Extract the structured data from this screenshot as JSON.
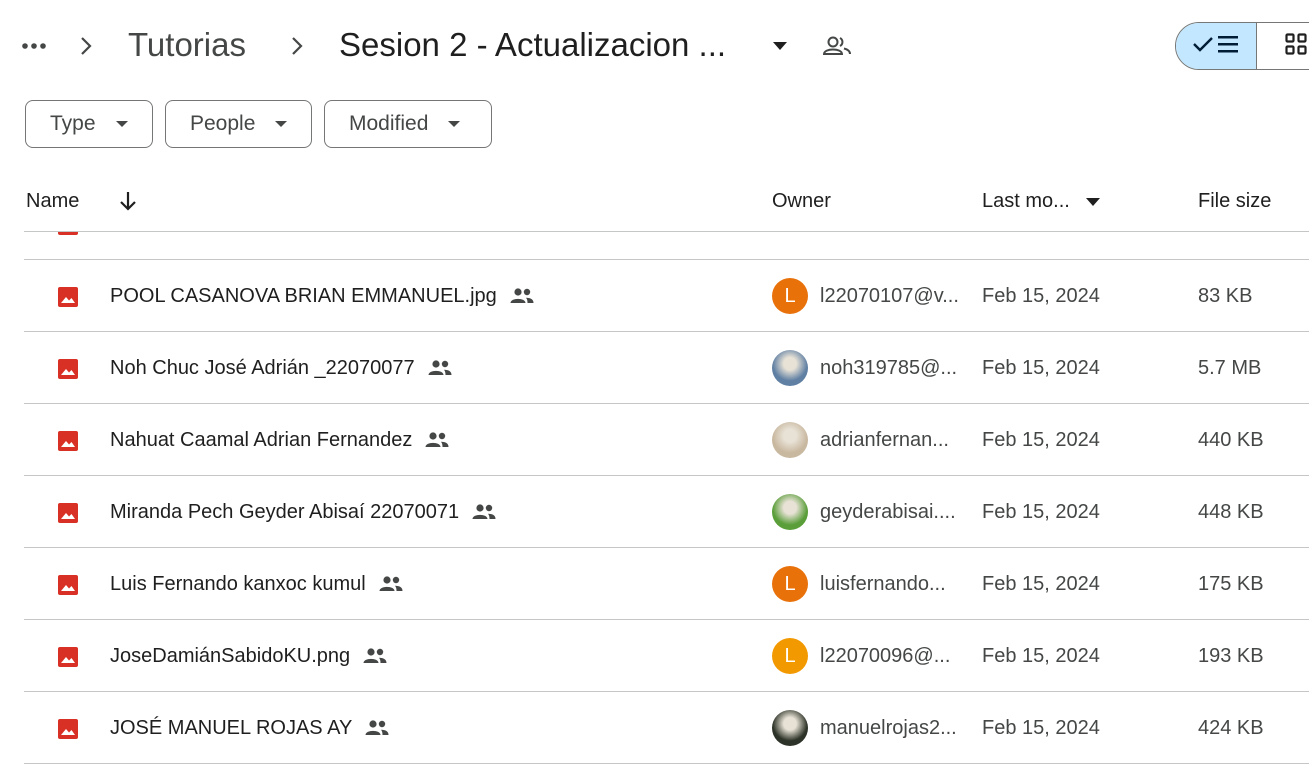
{
  "breadcrumb": {
    "items": [
      "Tutorias",
      "Sesion 2 - Actualizacion ..."
    ]
  },
  "view": {
    "list_icon": "checkmark-list-icon",
    "grid_icon": "grid-icon"
  },
  "filters": [
    {
      "label": "Type"
    },
    {
      "label": "People"
    },
    {
      "label": "Modified"
    }
  ],
  "columns": {
    "name": "Name",
    "owner": "Owner",
    "last_modified": "Last mo...",
    "file_size": "File size"
  },
  "rows": [
    {
      "name": "POOL CASANOVA BRIAN EMMANUEL.jpg",
      "owner": "l22070107@v...",
      "avatar_letter": "L",
      "avatar_color": "#e8710a",
      "modified": "Feb 15, 2024",
      "size": "83 KB"
    },
    {
      "name": "Noh Chuc José Adrián _22070077",
      "owner": "noh319785@...",
      "avatar_letter": "",
      "avatar_color": "#5f7fa3",
      "modified": "Feb 15, 2024",
      "size": "5.7 MB"
    },
    {
      "name": "Nahuat Caamal Adrian Fernandez",
      "owner": "adrianfernan...",
      "avatar_letter": "",
      "avatar_color": "#c9b8a0",
      "modified": "Feb 15, 2024",
      "size": "440 KB"
    },
    {
      "name": "Miranda Pech Geyder Abisaí 22070071",
      "owner": "geyderabisai....",
      "avatar_letter": "",
      "avatar_color": "#5a9e3a",
      "modified": "Feb 15, 2024",
      "size": "448 KB"
    },
    {
      "name": "Luis Fernando kanxoc kumul",
      "owner": "luisfernando...",
      "avatar_letter": "L",
      "avatar_color": "#e8710a",
      "modified": "Feb 15, 2024",
      "size": "175 KB"
    },
    {
      "name": "JoseDamiánSabidoKU.png",
      "owner": "l22070096@...",
      "avatar_letter": "L",
      "avatar_color": "#f29900",
      "modified": "Feb 15, 2024",
      "size": "193 KB"
    },
    {
      "name": "JOSÉ MANUEL ROJAS AY",
      "owner": "manuelrojas2...",
      "avatar_letter": "",
      "avatar_color": "#2d3328",
      "modified": "Feb 15, 2024",
      "size": "424 KB"
    }
  ],
  "colors": {
    "image_icon": "#d93025",
    "selected_toggle": "#c2e7ff",
    "divider": "#c4c7c5"
  }
}
